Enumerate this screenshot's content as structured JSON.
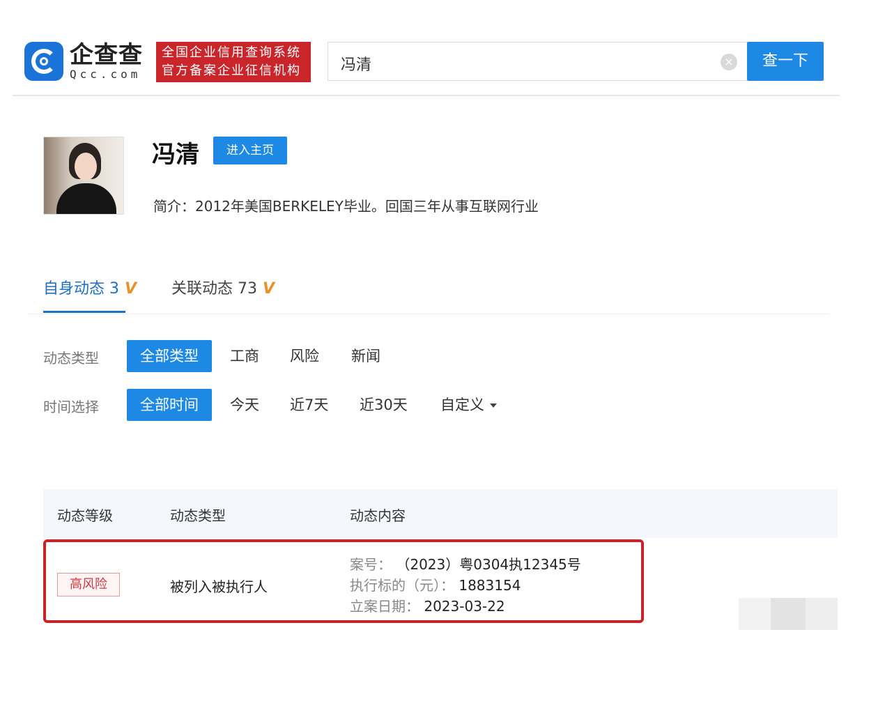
{
  "header": {
    "brand_name": "企查查",
    "brand_domain": "Qcc.com",
    "seal_line1": "全国企业信用查询系统",
    "seal_line2": "官方备案企业征信机构",
    "search_value": "冯清",
    "search_button": "查一下",
    "brand_color": "#1a73d9",
    "seal_color": "#c9252b"
  },
  "profile": {
    "name": "冯清",
    "home_button": "进入主页",
    "intro": "简介：2012年美国BERKELEY毕业。回国三年从事互联网行业"
  },
  "tabs": [
    {
      "label": "自身动态 3",
      "badge": "V",
      "active": true
    },
    {
      "label": "关联动态 73",
      "badge": "V",
      "active": false
    }
  ],
  "filters": {
    "type_label": "动态类型",
    "type_options": [
      "全部类型",
      "工商",
      "风险",
      "新闻"
    ],
    "time_label": "时间选择",
    "time_options": [
      "全部时间",
      "今天",
      "近7天",
      "近30天",
      "自定义"
    ]
  },
  "table": {
    "columns": [
      "动态等级",
      "动态类型",
      "动态内容"
    ],
    "rows": [
      {
        "level": "高风险",
        "type": "被列入被执行人",
        "case_no_label": "案号：",
        "case_no": "（2023）粤0304执12345号",
        "amount_label": "执行标的（元）：",
        "amount": "1883154",
        "date_label": "立案日期：",
        "date": "2023-03-22"
      }
    ]
  },
  "accent_color": "#1e88e5",
  "risk_color": "#c8232a"
}
